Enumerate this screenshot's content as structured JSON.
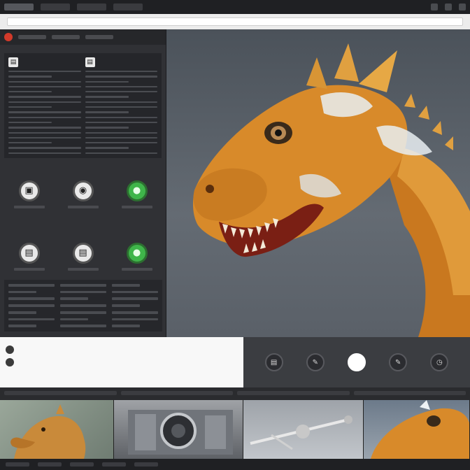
{
  "window": {
    "title": ""
  },
  "browser": {
    "address": ""
  },
  "left_panel": {
    "section_title": "",
    "icon_tiles": [
      {
        "icon": "document-icon",
        "accent": "#e9e9e9"
      },
      {
        "icon": "document-icon",
        "accent": "#e9e9e9"
      },
      {
        "icon": "green-status-icon",
        "accent": "#3fb54a"
      },
      {
        "icon": "document-icon",
        "accent": "#e9e9e9"
      },
      {
        "icon": "document-icon",
        "accent": "#e9e9e9"
      },
      {
        "icon": "green-status-icon",
        "accent": "#3fb54a"
      }
    ]
  },
  "info_panel": {
    "title": "",
    "subtitle": "",
    "author": ""
  },
  "controls": {
    "buttons": [
      "document-icon",
      "pencil-icon",
      "record-icon",
      "pencil-icon",
      "clock-icon"
    ]
  },
  "colors": {
    "accent_red": "#d23a2a",
    "accent_green": "#3fb54a",
    "dragon_orange": "#d88a2a"
  }
}
